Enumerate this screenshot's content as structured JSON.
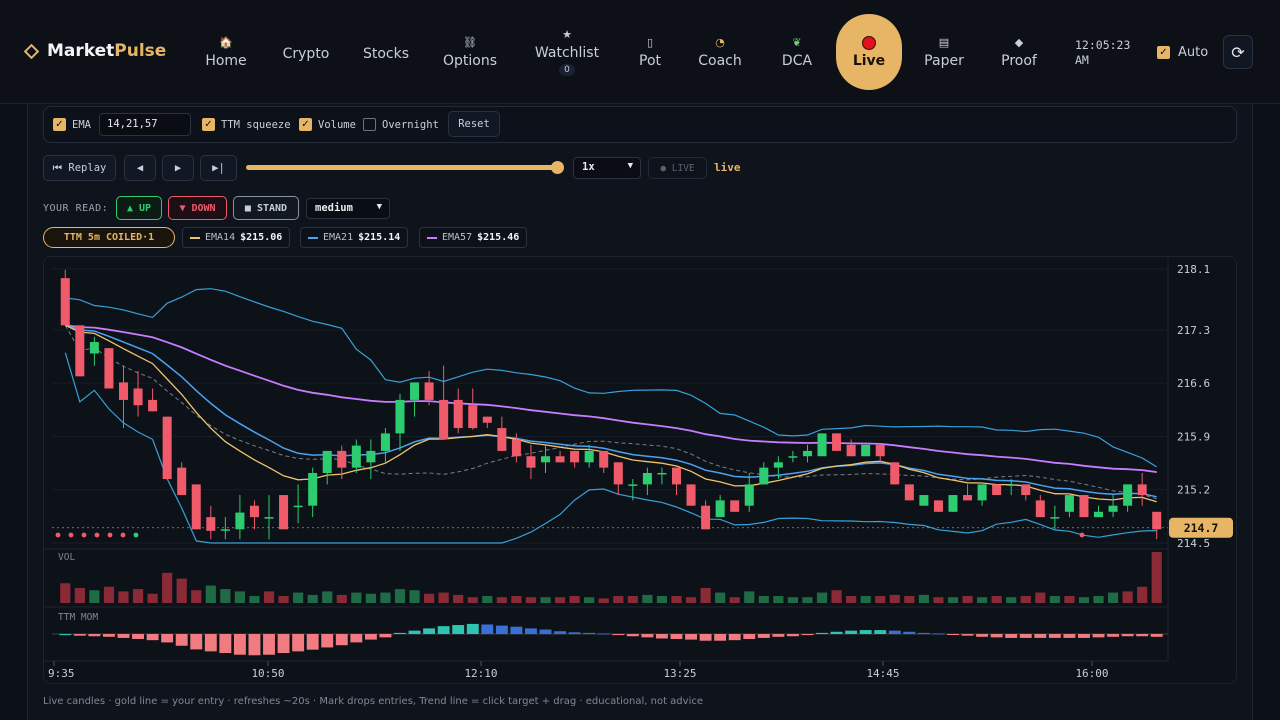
{
  "app": {
    "brand_main": "Market",
    "brand_accent": "Pulse"
  },
  "nav": [
    {
      "label": "Home",
      "icon": "house-icon"
    },
    {
      "label": "Crypto",
      "icon": ""
    },
    {
      "label": "Stocks",
      "icon": ""
    },
    {
      "label": "Options",
      "icon": "chain-link-icon"
    },
    {
      "label": "Watchlist",
      "icon": "star-icon",
      "badge": "0"
    },
    {
      "label": "Pot",
      "icon": "pot-icon"
    },
    {
      "label": "Coach",
      "icon": "clock-icon"
    },
    {
      "label": "DCA",
      "icon": "sprout-icon"
    },
    {
      "label": "Live",
      "icon": "red-dot-icon",
      "active": true
    },
    {
      "label": "Paper",
      "icon": "memo-icon"
    },
    {
      "label": "Proof",
      "icon": "diamond-icon"
    }
  ],
  "clock": {
    "time": "12:05:23",
    "ampm": "AM"
  },
  "auto": {
    "label": "Auto",
    "checked": true
  },
  "options_bar": {
    "ema_label": "EMA",
    "ema_checked": true,
    "ema_value": "14,21,57",
    "ttm_label": "TTM squeeze",
    "ttm_checked": true,
    "volume_label": "Volume",
    "volume_checked": true,
    "overnight_label": "Overnight",
    "overnight_checked": false,
    "reset_label": "Reset"
  },
  "replay": {
    "replay_label": "⏮ Replay",
    "prev_symbol": "◀",
    "play_symbol": "▶",
    "end_symbol": "▶|",
    "progress": 1.0,
    "speed": "1x",
    "live_badge": "● LIVE",
    "live_word": "live"
  },
  "read": {
    "label": "YOUR READ:",
    "up": "▲ UP",
    "down": "▼ DOWN",
    "stand": "■ STAND",
    "strength": "medium"
  },
  "ttm_chip": "TTM 5m COILED·1",
  "emas": [
    {
      "name": "EMA14",
      "value": "$215.06",
      "color": "#f0c36d"
    },
    {
      "name": "EMA21",
      "value": "$215.14",
      "color": "#4aa3f0"
    },
    {
      "name": "EMA57",
      "value": "$215.46",
      "color": "#c77dff"
    }
  ],
  "colors": {
    "accent": "#e6b566",
    "up": "#2ecc71",
    "down": "#f05b6b",
    "ema14": "#f0c36d",
    "ema21": "#4aa3f0",
    "ema57": "#c77dff",
    "band": "#38a0d8"
  },
  "chart_data": {
    "type": "candlestick",
    "y_ticks": [
      "218.1",
      "217.3",
      "216.6",
      "215.9",
      "215.2",
      "214.5"
    ],
    "ylim": [
      214.5,
      218.1
    ],
    "x_ticks": [
      "9:35",
      "10:50",
      "12:10",
      "13:25",
      "14:45",
      "16:00"
    ],
    "last_price": "214.7",
    "volume_label": "VOL",
    "momentum_label": "TTM MOM",
    "candles": [
      [
        217.98,
        218.09,
        217.36,
        217.36
      ],
      [
        217.36,
        217.36,
        216.69,
        216.69
      ],
      [
        216.99,
        217.21,
        216.83,
        217.14
      ],
      [
        217.06,
        217.06,
        216.53,
        216.53
      ],
      [
        216.61,
        216.83,
        216.01,
        216.38
      ],
      [
        216.53,
        216.76,
        216.16,
        216.31
      ],
      [
        216.38,
        216.53,
        216.23,
        216.23
      ],
      [
        216.16,
        216.16,
        215.34,
        215.34
      ],
      [
        215.49,
        215.56,
        215.13,
        215.13
      ],
      [
        215.27,
        215.27,
        214.68,
        214.68
      ],
      [
        214.84,
        214.99,
        214.55,
        214.66
      ],
      [
        214.68,
        214.84,
        214.55,
        214.68
      ],
      [
        214.68,
        215.13,
        214.55,
        214.9
      ],
      [
        214.99,
        215.06,
        214.68,
        214.84
      ],
      [
        214.84,
        215.13,
        214.55,
        214.84
      ],
      [
        215.13,
        215.13,
        214.68,
        214.68
      ],
      [
        214.99,
        215.27,
        214.76,
        214.99
      ],
      [
        214.99,
        215.49,
        214.84,
        215.42
      ],
      [
        215.42,
        215.71,
        215.27,
        215.71
      ],
      [
        215.71,
        215.78,
        215.34,
        215.49
      ],
      [
        215.49,
        215.86,
        215.42,
        215.78
      ],
      [
        215.56,
        215.86,
        215.34,
        215.71
      ],
      [
        215.71,
        216.01,
        215.56,
        215.94
      ],
      [
        215.94,
        216.46,
        215.71,
        216.38
      ],
      [
        216.38,
        216.61,
        216.16,
        216.61
      ],
      [
        216.61,
        216.76,
        216.31,
        216.38
      ],
      [
        216.38,
        216.83,
        215.86,
        215.86
      ],
      [
        216.38,
        216.53,
        215.94,
        216.01
      ],
      [
        216.31,
        216.53,
        215.99,
        216.01
      ],
      [
        216.16,
        216.16,
        216.01,
        216.08
      ],
      [
        216.01,
        216.16,
        215.71,
        215.71
      ],
      [
        215.86,
        215.94,
        215.56,
        215.64
      ],
      [
        215.64,
        215.79,
        215.34,
        215.49
      ],
      [
        215.56,
        215.79,
        215.42,
        215.64
      ],
      [
        215.64,
        215.71,
        215.56,
        215.56
      ],
      [
        215.71,
        215.71,
        215.49,
        215.56
      ],
      [
        215.56,
        215.79,
        215.49,
        215.71
      ],
      [
        215.71,
        215.71,
        215.42,
        215.49
      ],
      [
        215.56,
        215.56,
        215.13,
        215.27
      ],
      [
        215.27,
        215.34,
        215.06,
        215.27
      ],
      [
        215.27,
        215.49,
        215.13,
        215.42
      ],
      [
        215.42,
        215.49,
        215.27,
        215.42
      ],
      [
        215.49,
        215.49,
        215.13,
        215.27
      ],
      [
        215.27,
        215.27,
        214.99,
        214.99
      ],
      [
        214.99,
        215.06,
        214.68,
        214.68
      ],
      [
        214.84,
        215.13,
        214.84,
        215.06
      ],
      [
        215.06,
        215.06,
        214.91,
        214.91
      ],
      [
        214.99,
        215.42,
        214.91,
        215.27
      ],
      [
        215.27,
        215.56,
        215.27,
        215.49
      ],
      [
        215.49,
        215.64,
        215.34,
        215.56
      ],
      [
        215.64,
        215.71,
        215.56,
        215.64
      ],
      [
        215.64,
        215.79,
        215.56,
        215.71
      ],
      [
        215.64,
        215.94,
        215.64,
        215.94
      ],
      [
        215.94,
        215.94,
        215.71,
        215.71
      ],
      [
        215.79,
        215.86,
        215.64,
        215.64
      ],
      [
        215.64,
        215.79,
        215.64,
        215.79
      ],
      [
        215.79,
        215.79,
        215.56,
        215.64
      ],
      [
        215.56,
        215.56,
        215.27,
        215.27
      ],
      [
        215.27,
        215.27,
        215.06,
        215.06
      ],
      [
        214.99,
        215.13,
        214.99,
        215.13
      ],
      [
        215.06,
        215.06,
        214.91,
        214.91
      ],
      [
        214.91,
        215.13,
        214.91,
        215.13
      ],
      [
        215.13,
        215.27,
        215.06,
        215.06
      ],
      [
        215.06,
        215.27,
        214.99,
        215.27
      ],
      [
        215.27,
        215.27,
        215.13,
        215.13
      ],
      [
        215.27,
        215.34,
        215.13,
        215.27
      ],
      [
        215.27,
        215.27,
        215.06,
        215.13
      ],
      [
        215.06,
        215.13,
        214.84,
        214.84
      ],
      [
        214.84,
        214.99,
        214.68,
        214.84
      ],
      [
        214.91,
        215.13,
        214.84,
        215.13
      ],
      [
        215.13,
        215.13,
        214.84,
        214.84
      ],
      [
        214.84,
        214.99,
        214.84,
        214.91
      ],
      [
        214.91,
        215.13,
        214.84,
        214.99
      ],
      [
        214.99,
        215.27,
        214.91,
        215.27
      ],
      [
        215.27,
        215.42,
        214.99,
        215.13
      ],
      [
        214.91,
        214.91,
        214.55,
        214.68
      ]
    ],
    "volume": [
      [
        0.34,
        "d"
      ],
      [
        0.26,
        "d"
      ],
      [
        0.22,
        "u"
      ],
      [
        0.28,
        "d"
      ],
      [
        0.2,
        "d"
      ],
      [
        0.24,
        "d"
      ],
      [
        0.16,
        "d"
      ],
      [
        0.52,
        "d"
      ],
      [
        0.42,
        "d"
      ],
      [
        0.22,
        "d"
      ],
      [
        0.3,
        "u"
      ],
      [
        0.24,
        "u"
      ],
      [
        0.2,
        "u"
      ],
      [
        0.12,
        "u"
      ],
      [
        0.2,
        "d"
      ],
      [
        0.12,
        "d"
      ],
      [
        0.18,
        "u"
      ],
      [
        0.14,
        "u"
      ],
      [
        0.2,
        "u"
      ],
      [
        0.14,
        "d"
      ],
      [
        0.18,
        "u"
      ],
      [
        0.16,
        "u"
      ],
      [
        0.18,
        "u"
      ],
      [
        0.24,
        "u"
      ],
      [
        0.22,
        "u"
      ],
      [
        0.16,
        "d"
      ],
      [
        0.18,
        "d"
      ],
      [
        0.14,
        "d"
      ],
      [
        0.1,
        "d"
      ],
      [
        0.12,
        "u"
      ],
      [
        0.1,
        "d"
      ],
      [
        0.12,
        "d"
      ],
      [
        0.1,
        "d"
      ],
      [
        0.1,
        "u"
      ],
      [
        0.1,
        "d"
      ],
      [
        0.12,
        "d"
      ],
      [
        0.1,
        "u"
      ],
      [
        0.08,
        "d"
      ],
      [
        0.12,
        "d"
      ],
      [
        0.12,
        "d"
      ],
      [
        0.14,
        "u"
      ],
      [
        0.12,
        "u"
      ],
      [
        0.12,
        "d"
      ],
      [
        0.1,
        "d"
      ],
      [
        0.26,
        "d"
      ],
      [
        0.18,
        "u"
      ],
      [
        0.1,
        "d"
      ],
      [
        0.2,
        "u"
      ],
      [
        0.12,
        "u"
      ],
      [
        0.12,
        "u"
      ],
      [
        0.1,
        "u"
      ],
      [
        0.1,
        "u"
      ],
      [
        0.18,
        "u"
      ],
      [
        0.22,
        "d"
      ],
      [
        0.12,
        "d"
      ],
      [
        0.12,
        "u"
      ],
      [
        0.12,
        "d"
      ],
      [
        0.14,
        "d"
      ],
      [
        0.12,
        "d"
      ],
      [
        0.14,
        "u"
      ],
      [
        0.1,
        "d"
      ],
      [
        0.1,
        "u"
      ],
      [
        0.12,
        "d"
      ],
      [
        0.1,
        "u"
      ],
      [
        0.12,
        "d"
      ],
      [
        0.1,
        "u"
      ],
      [
        0.12,
        "d"
      ],
      [
        0.18,
        "d"
      ],
      [
        0.12,
        "u"
      ],
      [
        0.12,
        "d"
      ],
      [
        0.1,
        "u"
      ],
      [
        0.12,
        "u"
      ],
      [
        0.18,
        "u"
      ],
      [
        0.2,
        "d"
      ],
      [
        0.28,
        "d"
      ],
      [
        0.88,
        "d"
      ]
    ],
    "momentum": [
      [
        -0.04,
        "c"
      ],
      [
        -0.06,
        "r"
      ],
      [
        -0.08,
        "r"
      ],
      [
        -0.1,
        "r"
      ],
      [
        -0.14,
        "r"
      ],
      [
        -0.18,
        "r"
      ],
      [
        -0.22,
        "r"
      ],
      [
        -0.3,
        "r"
      ],
      [
        -0.42,
        "r"
      ],
      [
        -0.55,
        "r"
      ],
      [
        -0.62,
        "r"
      ],
      [
        -0.68,
        "r"
      ],
      [
        -0.74,
        "r"
      ],
      [
        -0.76,
        "r"
      ],
      [
        -0.74,
        "r"
      ],
      [
        -0.68,
        "r"
      ],
      [
        -0.62,
        "r"
      ],
      [
        -0.56,
        "r"
      ],
      [
        -0.48,
        "r"
      ],
      [
        -0.4,
        "r"
      ],
      [
        -0.3,
        "r"
      ],
      [
        -0.2,
        "r"
      ],
      [
        -0.12,
        "r"
      ],
      [
        0.04,
        "c"
      ],
      [
        0.12,
        "c"
      ],
      [
        0.2,
        "c"
      ],
      [
        0.28,
        "c"
      ],
      [
        0.32,
        "c"
      ],
      [
        0.36,
        "c"
      ],
      [
        0.34,
        "b"
      ],
      [
        0.3,
        "b"
      ],
      [
        0.26,
        "b"
      ],
      [
        0.2,
        "b"
      ],
      [
        0.16,
        "b"
      ],
      [
        0.1,
        "b"
      ],
      [
        0.06,
        "b"
      ],
      [
        0.04,
        "b"
      ],
      [
        0.02,
        "b"
      ],
      [
        -0.04,
        "r"
      ],
      [
        -0.08,
        "r"
      ],
      [
        -0.12,
        "r"
      ],
      [
        -0.16,
        "r"
      ],
      [
        -0.18,
        "r"
      ],
      [
        -0.2,
        "r"
      ],
      [
        -0.24,
        "r"
      ],
      [
        -0.24,
        "r"
      ],
      [
        -0.22,
        "r"
      ],
      [
        -0.18,
        "r"
      ],
      [
        -0.14,
        "r"
      ],
      [
        -0.1,
        "r"
      ],
      [
        -0.08,
        "r"
      ],
      [
        -0.04,
        "r"
      ],
      [
        0.04,
        "c"
      ],
      [
        0.08,
        "c"
      ],
      [
        0.12,
        "c"
      ],
      [
        0.14,
        "c"
      ],
      [
        0.14,
        "c"
      ],
      [
        0.12,
        "b"
      ],
      [
        0.08,
        "b"
      ],
      [
        0.04,
        "b"
      ],
      [
        0.02,
        "b"
      ],
      [
        -0.02,
        "r"
      ],
      [
        -0.06,
        "r"
      ],
      [
        -0.1,
        "r"
      ],
      [
        -0.12,
        "r"
      ],
      [
        -0.14,
        "r"
      ],
      [
        -0.14,
        "r"
      ],
      [
        -0.14,
        "r"
      ],
      [
        -0.14,
        "r"
      ],
      [
        -0.14,
        "r"
      ],
      [
        -0.14,
        "r"
      ],
      [
        -0.12,
        "r"
      ],
      [
        -0.1,
        "r"
      ],
      [
        -0.08,
        "r"
      ],
      [
        -0.08,
        "r"
      ],
      [
        -0.1,
        "r"
      ]
    ]
  },
  "footer": "Live candles · gold line = your entry · refreshes ~20s · Mark drops entries, Trend line = click target + drag · educational, not advice"
}
